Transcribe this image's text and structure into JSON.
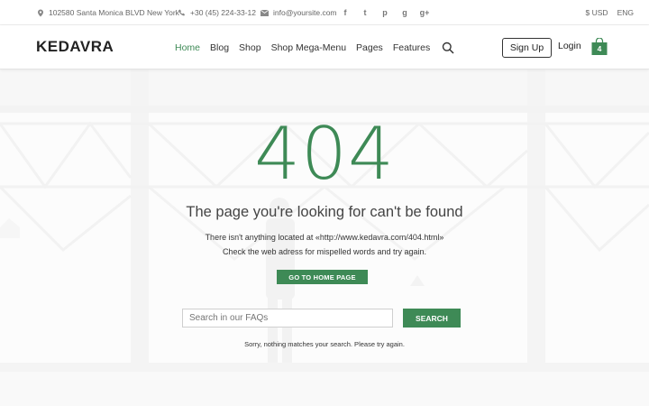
{
  "topbar": {
    "address": "102580 Santa Monica BLVD New York",
    "phone": "+30 (45) 224-33-12",
    "email": "info@yoursite.com",
    "social": [
      "f",
      "t",
      "p",
      "g",
      "g+"
    ],
    "currency": "$ USD",
    "language": "ENG"
  },
  "header": {
    "logo": "KEDAVRA",
    "nav": [
      "Home",
      "Blog",
      "Shop",
      "Shop Mega-Menu",
      "Pages",
      "Features"
    ],
    "signup": "Sign Up",
    "login": "Login",
    "cart_count": "4"
  },
  "error": {
    "code": "404",
    "title": "The page you're looking for can't be found",
    "line1": "There isn't anything located at «http://www.kedavra.com/404.html»",
    "line2": "Check the web adress for mispelled words and try again.",
    "home_button": "GO TO HOME PAGE"
  },
  "search": {
    "placeholder": "Search in our FAQs",
    "button": "SEARCH",
    "result": "Sorry, nothing matches your search. Please try again."
  },
  "colors": {
    "accent": "#3e8a56"
  }
}
